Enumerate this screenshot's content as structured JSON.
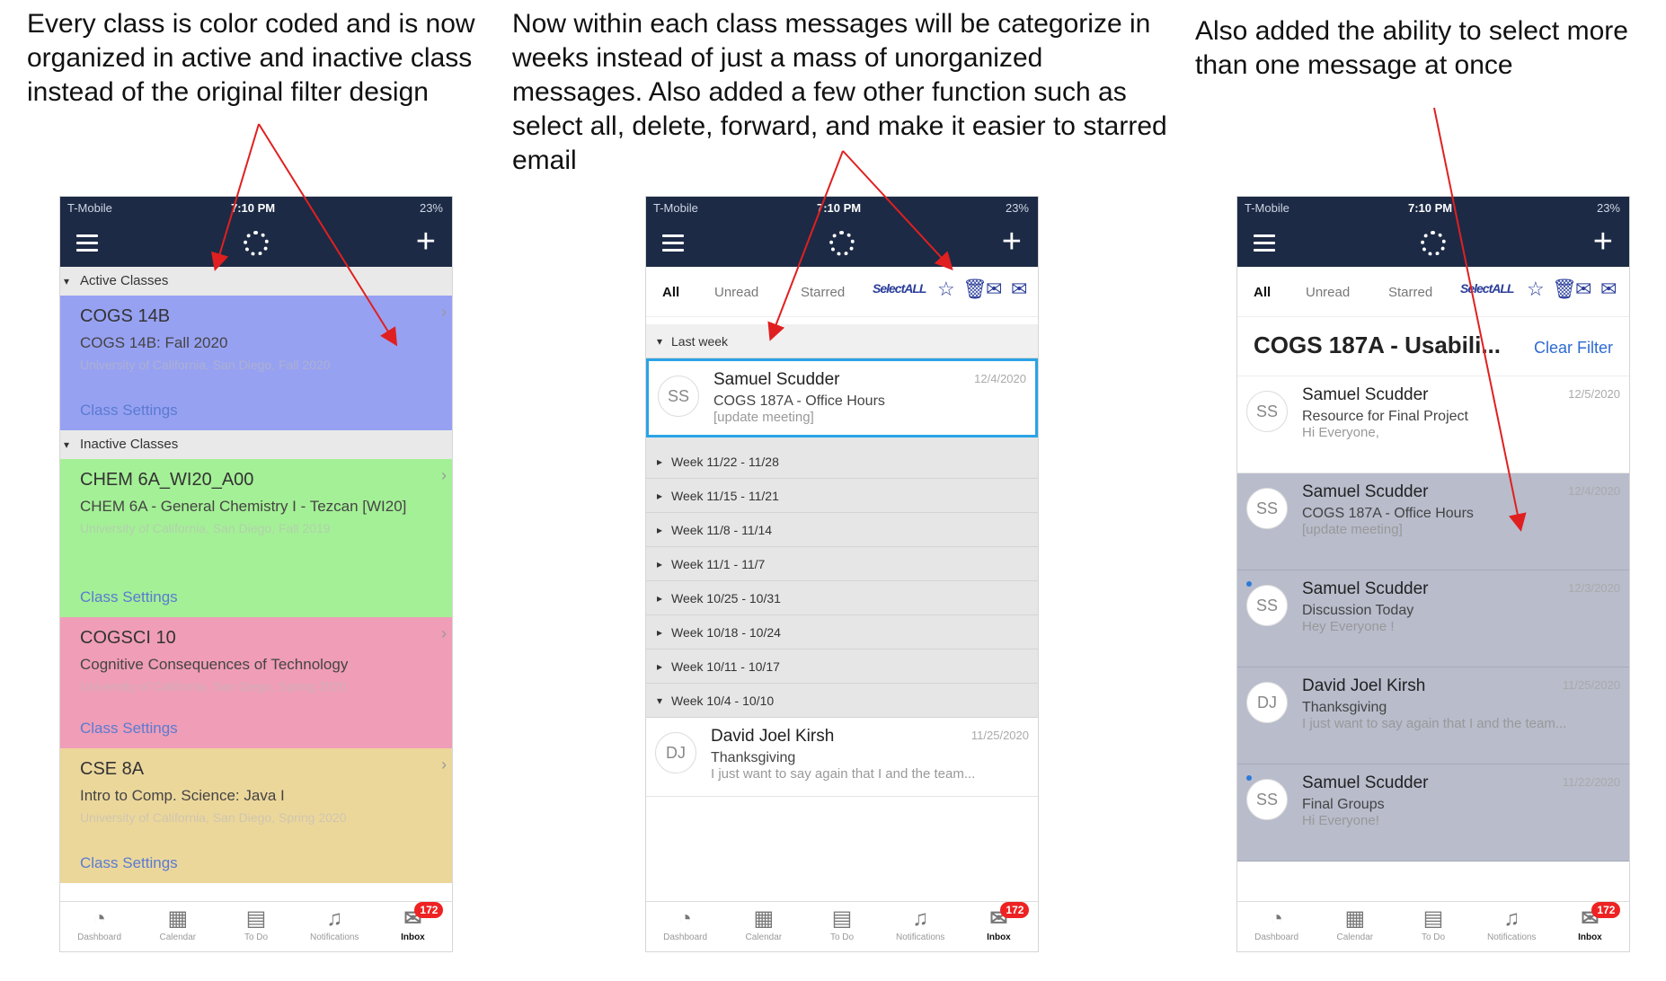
{
  "annotations": {
    "left": [
      "Every class is color coded and is now",
      "organized in active and inactive class",
      "instead of the original filter design"
    ],
    "middle": [
      "Now within each class messages will be categorize in",
      "weeks instead of just a mass of unorganized",
      "messages. Also added a few other function such as",
      "select all, delete, forward, and make it easier to starred",
      "email"
    ],
    "right": [
      "Also added the ability to select more",
      "than one message at once"
    ]
  },
  "status": {
    "carrier": "T-Mobile",
    "time": "7:10 PM",
    "battery": "23%"
  },
  "colors": {
    "navbar": "#1c2a45",
    "cogs14b": "#97a1f2",
    "chem6a": "#a4f096",
    "cogsci10": "#f09db7",
    "cse8a": "#ecd79b",
    "selected": "#b8bccb"
  },
  "phone1": {
    "active_header": "Active Classes",
    "inactive_header": "Inactive Classes",
    "classes": [
      {
        "code": "COGS 14B",
        "name": "COGS 14B: Fall 2020",
        "uni": "University of California, San Diego, Fall 2020",
        "settings": "Class Settings"
      },
      {
        "code": "CHEM 6A_WI20_A00",
        "name": "CHEM 6A - General Chemistry I - Tezcan [WI20]",
        "uni": "University of California, San Diego, Fall 2019",
        "settings": "Class Settings"
      },
      {
        "code": "COGSCI 10",
        "name": "Cognitive Consequences of Technology",
        "uni": "University of California, San Diego, Spring 2020",
        "settings": "Class Settings"
      },
      {
        "code": "CSE 8A",
        "name": "Intro to Comp. Science: Java I",
        "uni": "University of California, San Diego, Spring 2020",
        "settings": "Class Settings"
      }
    ]
  },
  "filters": {
    "all": "All",
    "unread": "Unread",
    "starred": "Starred",
    "select_all": "SelectALL"
  },
  "phone2": {
    "last_week": "Last week",
    "selected_msg": {
      "initials": "SS",
      "sender": "Samuel Scudder",
      "subject": "COGS 187A - Office Hours",
      "preview": "[update meeting]",
      "date": "12/4/2020"
    },
    "weeks": [
      "Week 11/22 - 11/28",
      "Week 11/15 - 11/21",
      "Week 11/8 - 11/14",
      "Week 11/1 - 11/7",
      "Week 10/25 - 10/31",
      "Week 10/18 - 10/24",
      "Week 10/11 - 10/17"
    ],
    "open_week": "Week 10/4 - 10/10",
    "week_msg": {
      "initials": "DJ",
      "sender": "David Joel Kirsh",
      "subject": "Thanksgiving",
      "preview": "I just want to say again that I and the team...",
      "date": "11/25/2020"
    }
  },
  "phone3": {
    "filter_title": "COGS 187A - Usabili...",
    "clear_filter": "Clear Filter",
    "messages": [
      {
        "initials": "SS",
        "sender": "Samuel Scudder",
        "subject": "Resource for Final Project",
        "preview": "Hi Everyone,",
        "date": "12/5/2020"
      },
      {
        "initials": "SS",
        "sender": "Samuel Scudder",
        "subject": "COGS 187A - Office Hours",
        "preview": "[update meeting]",
        "date": "12/4/2020"
      },
      {
        "initials": "SS",
        "sender": "Samuel Scudder",
        "subject": "Discussion Today",
        "preview": "Hey Everyone !",
        "date": "12/3/2020"
      },
      {
        "initials": "DJ",
        "sender": "David Joel Kirsh",
        "subject": "Thanksgiving",
        "preview": "I just want to say again that I and the team...",
        "date": "11/25/2020"
      },
      {
        "initials": "SS",
        "sender": "Samuel Scudder",
        "subject": "Final Groups",
        "preview": "Hi Everyone!",
        "date": "11/22/2020"
      }
    ]
  },
  "tabbar": {
    "dashboard": "Dashboard",
    "calendar": "Calendar",
    "todo": "To Do",
    "notifications": "Notifications",
    "inbox": "Inbox",
    "badge": "172"
  }
}
